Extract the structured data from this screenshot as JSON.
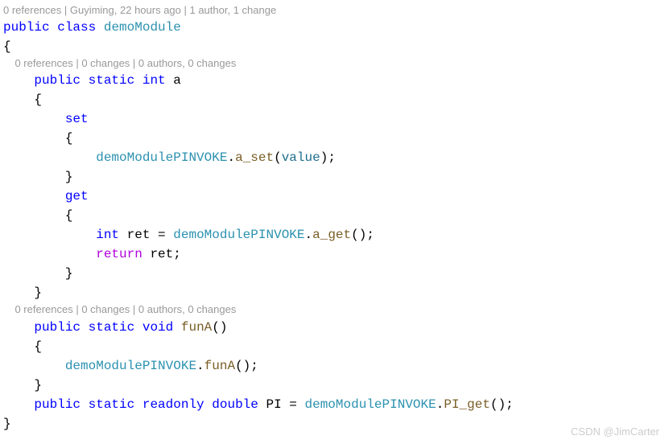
{
  "codelens": {
    "class": "0 references | Guyiming, 22 hours ago | 1 author, 1 change",
    "member1": "0 references | 0 changes | 0 authors, 0 changes",
    "member2": "0 references | 0 changes | 0 authors, 0 changes"
  },
  "kw": {
    "public": "public",
    "class": "class",
    "static": "static",
    "int": "int",
    "set": "set",
    "get": "get",
    "return": "return",
    "void": "void",
    "readonly": "readonly",
    "double": "double"
  },
  "types": {
    "demoModule": "demoModule",
    "pinvoke": "demoModulePINVOKE"
  },
  "identifiers": {
    "a": "a",
    "value": "value",
    "ret": "ret",
    "PI": "PI"
  },
  "methods": {
    "a_set": "a_set",
    "a_get": "a_get",
    "funA": "funA",
    "PI_get": "PI_get"
  },
  "punct": {
    "lbrace": "{",
    "rbrace": "}",
    "lparen": "(",
    "rparen": ")",
    "semi": ";",
    "dot": ".",
    "eq": " = "
  },
  "watermark": "CSDN @JimCarter"
}
